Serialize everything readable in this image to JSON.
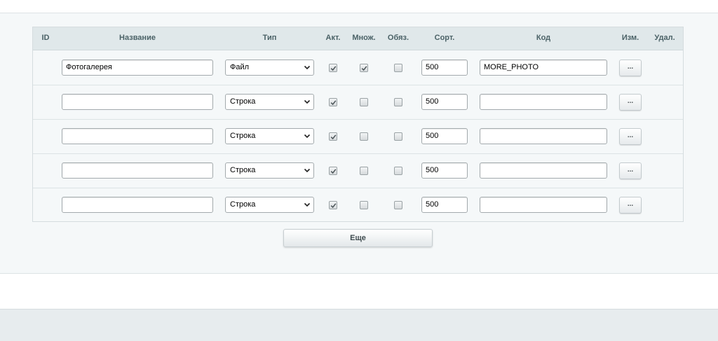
{
  "table": {
    "headers": {
      "id": "ID",
      "name": "Название",
      "type": "Тип",
      "active": "Акт.",
      "multiple": "Множ.",
      "required": "Обяз.",
      "sort": "Сорт.",
      "code": "Код",
      "edit": "Изм.",
      "delete": "Удал."
    },
    "rows": [
      {
        "name": "Фотогалерея",
        "type": "Файл",
        "active": true,
        "multiple": true,
        "required": false,
        "sort": "500",
        "code": "MORE_PHOTO",
        "edit_label": "..."
      },
      {
        "name": "",
        "type": "Строка",
        "active": true,
        "multiple": false,
        "required": false,
        "sort": "500",
        "code": "",
        "edit_label": "..."
      },
      {
        "name": "",
        "type": "Строка",
        "active": true,
        "multiple": false,
        "required": false,
        "sort": "500",
        "code": "",
        "edit_label": "..."
      },
      {
        "name": "",
        "type": "Строка",
        "active": true,
        "multiple": false,
        "required": false,
        "sort": "500",
        "code": "",
        "edit_label": "..."
      },
      {
        "name": "",
        "type": "Строка",
        "active": true,
        "multiple": false,
        "required": false,
        "sort": "500",
        "code": "",
        "edit_label": "..."
      }
    ]
  },
  "more_button_label": "Еще",
  "icons": {
    "select_arrow": "chevron-down-icon",
    "checkbox_mark": "check-icon"
  }
}
